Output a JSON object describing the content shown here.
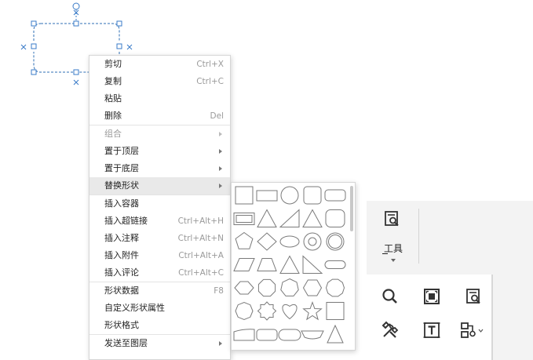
{
  "context_menu": {
    "items": [
      {
        "label": "剪切",
        "shortcut": "Ctrl+X"
      },
      {
        "label": "复制",
        "shortcut": "Ctrl+C"
      },
      {
        "label": "粘贴",
        "shortcut": ""
      },
      {
        "label": "删除",
        "shortcut": "Del"
      },
      {
        "label": "组合",
        "shortcut": "",
        "submenu": true,
        "disabled": true
      },
      {
        "label": "置于顶层",
        "shortcut": "",
        "submenu": true
      },
      {
        "label": "置于底层",
        "shortcut": "",
        "submenu": true
      },
      {
        "label": "替换形状",
        "shortcut": "",
        "submenu": true,
        "hover": true
      },
      {
        "label": "插入容器",
        "shortcut": ""
      },
      {
        "label": "插入超链接",
        "shortcut": "Ctrl+Alt+H"
      },
      {
        "label": "插入注释",
        "shortcut": "Ctrl+Alt+N"
      },
      {
        "label": "插入附件",
        "shortcut": "Ctrl+Alt+A"
      },
      {
        "label": "插入评论",
        "shortcut": "Ctrl+Alt+C"
      },
      {
        "label": "形状数据",
        "shortcut": "F8"
      },
      {
        "label": "自定义形状属性",
        "shortcut": ""
      },
      {
        "label": "形状格式",
        "shortcut": ""
      },
      {
        "label": "发送至图层",
        "shortcut": "",
        "submenu": true
      }
    ]
  },
  "shape_submenu": {
    "rows": [
      [
        "rectangle",
        "wide-rectangle",
        "circle",
        "rounded-square",
        "rounded-wide-rectangle"
      ],
      [
        "double-rectangle",
        "triangle",
        "right-triangle",
        "isosceles-triangle",
        "rounded-rectangle"
      ],
      [
        "pentagon",
        "diamond",
        "ellipse",
        "double-circle",
        "ring"
      ],
      [
        "parallelogram",
        "trapezoid",
        "triangle-outline",
        "right-triangle-outline",
        "capsule"
      ],
      [
        "hexagon-horizontal",
        "octagon",
        "heptagon",
        "rounded-hexagon",
        "decagon"
      ],
      [
        "cross-octagon",
        "star-8",
        "heart",
        "star-5",
        "square"
      ],
      [
        "wave-trapezoid",
        "rounded-box",
        "pill",
        "banner",
        "triangle-tall"
      ]
    ]
  },
  "toolbar": {
    "tools_label": "工具",
    "buttons": [
      {
        "name": "search-icon"
      },
      {
        "name": "fit-page-icon"
      },
      {
        "name": "find-replace-icon"
      },
      {
        "name": "tools-icon"
      },
      {
        "name": "text-box-icon"
      },
      {
        "name": "connector-icon"
      }
    ]
  },
  "colors": {
    "selection": "#2f6fb5",
    "handle": "#3a7bc8",
    "menu_hover": "#e9e9e9",
    "shortcut": "#9a9a9a"
  }
}
